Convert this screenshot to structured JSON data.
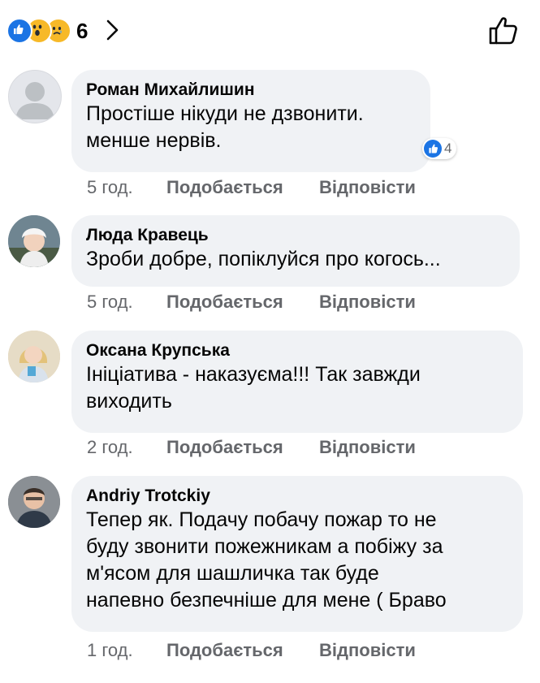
{
  "header": {
    "reaction_icons": [
      "like-icon",
      "wow-icon",
      "sad-icon"
    ],
    "reaction_count": "6"
  },
  "comments": [
    {
      "author": "Роман Михайлишин",
      "text": "Простіше нікуди не дзвонити.\nменше нервів.",
      "time": "5 год.",
      "like_label": "Подобається",
      "reply_label": "Відповісти",
      "reaction_count": "4",
      "avatar": "default-avatar"
    },
    {
      "author": "Люда Кравець",
      "text": "Зроби добре, попіклуйся про когось...",
      "time": "5 год.",
      "like_label": "Подобається",
      "reply_label": "Відповісти",
      "avatar": "photo-avatar"
    },
    {
      "author": "Оксана Крупська",
      "text": "Ініціатива - наказуєма!!! Так завжди\nвиходить",
      "time": "2 год.",
      "like_label": "Подобається",
      "reply_label": "Відповісти",
      "avatar": "photo-avatar"
    },
    {
      "author": "Andriy Trotckiy",
      "text": "Тепер як. Подачу побачу пожар то не\nбуду звонити пожежникам а побіжу за\nм'ясом для шашличка  так буде\nнапевно безпечніше для мене ( Браво",
      "time": "1 год.",
      "like_label": "Подобається",
      "reply_label": "Відповісти",
      "avatar": "photo-avatar"
    }
  ],
  "colors": {
    "bubble": "#f0f2f5",
    "meta_text": "#65676b",
    "like_blue": "#1b74e4",
    "reaction_yellow": "#f7b928"
  }
}
